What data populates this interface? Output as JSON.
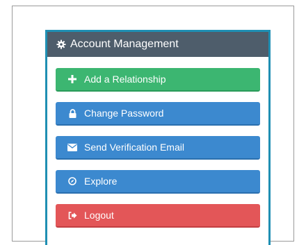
{
  "panel": {
    "title": "Account Management",
    "title_icon": "gear-icon",
    "accent_color": "#1f8fb3",
    "header_color": "#4e5d6b"
  },
  "buttons": [
    {
      "label": "Add a Relationship",
      "icon": "plus-icon",
      "color": "#3cb671"
    },
    {
      "label": "Change Password",
      "icon": "lock-icon",
      "color": "#3c89cf"
    },
    {
      "label": "Send Verification Email",
      "icon": "envelope-icon",
      "color": "#3c89cf"
    },
    {
      "label": "Explore",
      "icon": "compass-icon",
      "color": "#3c89cf"
    },
    {
      "label": "Logout",
      "icon": "logout-icon",
      "color": "#e35658"
    }
  ]
}
